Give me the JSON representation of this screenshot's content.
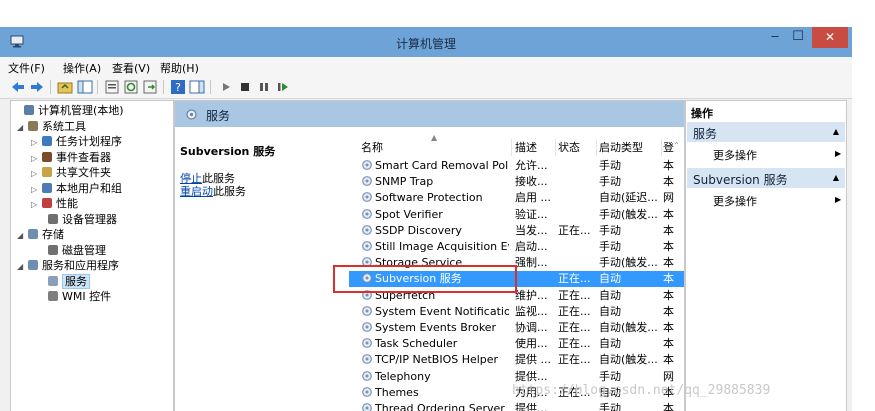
{
  "window": {
    "title": "计算机管理"
  },
  "menu": [
    "文件(F)",
    "操作(A)",
    "查看(V)",
    "帮助(H)"
  ],
  "tree": {
    "items": [
      {
        "label": "计算机管理(本地)",
        "icon": "computer-management-icon",
        "arrow": ""
      },
      {
        "label": "系统工具",
        "icon": "tools-icon",
        "arrow": "◢"
      },
      {
        "label": "任务计划程序",
        "icon": "clock-icon",
        "arrow": "▷"
      },
      {
        "label": "事件查看器",
        "icon": "event-viewer-icon",
        "arrow": "▷"
      },
      {
        "label": "共享文件夹",
        "icon": "shared-folder-icon",
        "arrow": "▷"
      },
      {
        "label": "本地用户和组",
        "icon": "users-icon",
        "arrow": "▷"
      },
      {
        "label": "性能",
        "icon": "performance-icon",
        "arrow": "▷"
      },
      {
        "label": "设备管理器",
        "icon": "device-manager-icon",
        "arrow": ""
      },
      {
        "label": "存储",
        "icon": "storage-icon",
        "arrow": "◢"
      },
      {
        "label": "磁盘管理",
        "icon": "disk-icon",
        "arrow": ""
      },
      {
        "label": "服务和应用程序",
        "icon": "services-apps-icon",
        "arrow": "◢"
      },
      {
        "label": "服务",
        "icon": "gear-icon",
        "arrow": ""
      },
      {
        "label": "WMI 控件",
        "icon": "wmi-icon",
        "arrow": ""
      }
    ]
  },
  "center": {
    "header": "服务",
    "selected_service": "Subversion 服务",
    "stop_link": "停止",
    "stop_rest": "此服务",
    "restart_link": "重启动",
    "restart_rest": "此服务",
    "columns": [
      "名称",
      "描述",
      "状态",
      "启动类型",
      "登"
    ],
    "rows": [
      {
        "name": "Smart Card Removal Poli...",
        "desc": "允许...",
        "status": "",
        "startup": "手动",
        "logon": "本"
      },
      {
        "name": "SNMP Trap",
        "desc": "接收...",
        "status": "",
        "startup": "手动",
        "logon": "本"
      },
      {
        "name": "Software Protection",
        "desc": "启用 ...",
        "status": "",
        "startup": "自动(延迟...",
        "logon": "网"
      },
      {
        "name": "Spot Verifier",
        "desc": "验证...",
        "status": "",
        "startup": "手动(触发...",
        "logon": "本"
      },
      {
        "name": "SSDP Discovery",
        "desc": "当发...",
        "status": "正在...",
        "startup": "手动",
        "logon": "本"
      },
      {
        "name": "Still Image Acquisition Ev...",
        "desc": "启动...",
        "status": "",
        "startup": "手动",
        "logon": "本"
      },
      {
        "name": "Storage Service",
        "desc": "强制...",
        "status": "",
        "startup": "手动(触发...",
        "logon": "本"
      },
      {
        "name": "Subversion 服务",
        "desc": "",
        "status": "正在...",
        "startup": "自动",
        "logon": "本"
      },
      {
        "name": "Superfetch",
        "desc": "维护...",
        "status": "正在...",
        "startup": "自动",
        "logon": "本"
      },
      {
        "name": "System Event Notification...",
        "desc": "监视...",
        "status": "正在...",
        "startup": "自动",
        "logon": "本"
      },
      {
        "name": "System Events Broker",
        "desc": "协调...",
        "status": "正在...",
        "startup": "自动(触发...",
        "logon": "本"
      },
      {
        "name": "Task Scheduler",
        "desc": "使用...",
        "status": "正在...",
        "startup": "自动",
        "logon": "本"
      },
      {
        "name": "TCP/IP NetBIOS Helper",
        "desc": "提供 ...",
        "status": "正在...",
        "startup": "自动(触发...",
        "logon": "本"
      },
      {
        "name": "Telephony",
        "desc": "提供...",
        "status": "",
        "startup": "手动",
        "logon": "网"
      },
      {
        "name": "Themes",
        "desc": "为用...",
        "status": "正在...",
        "startup": "自动",
        "logon": "本"
      },
      {
        "name": "Thread Ordering Server",
        "desc": "提供...",
        "status": "",
        "startup": "手动",
        "logon": "本"
      }
    ]
  },
  "actions": {
    "title": "操作",
    "sections": [
      {
        "label": "服务",
        "item": "更多操作"
      },
      {
        "label": "Subversion 服务",
        "item": "更多操作"
      }
    ]
  },
  "watermark": "https://blog.csdn.net/qq_29885839",
  "colors": {
    "titlebar": "#6ea3d8",
    "close": "#c94c42",
    "selection": "#3399ff",
    "highlight_box": "#d9302c"
  }
}
